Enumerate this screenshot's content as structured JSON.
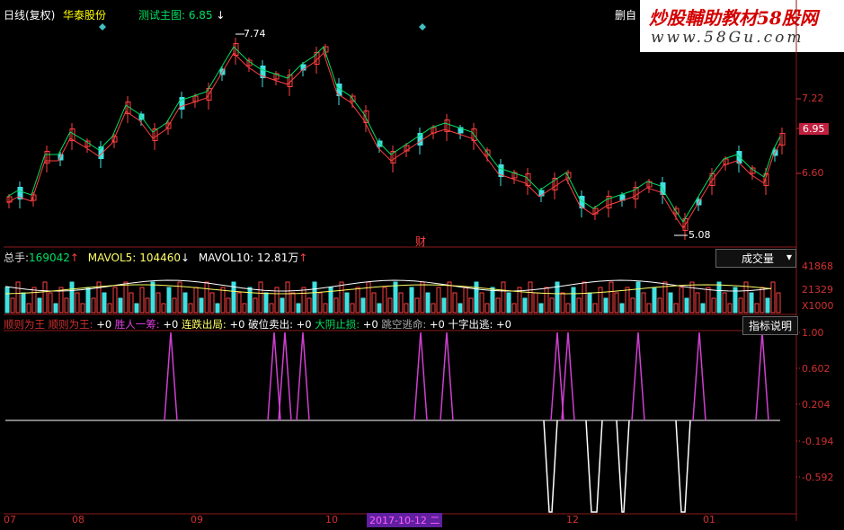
{
  "header": {
    "title": "日线(复权)",
    "stock": "华泰股份",
    "indicator": "测试主图: 6.85",
    "indicator_arrow": "↓",
    "right_btn": "删自",
    "colors": {
      "title": "#ffffff",
      "stock": "#ffff00",
      "indicator": "#00e060"
    }
  },
  "watermark": {
    "line1": "炒股輔助教材58股网",
    "line2": "www.58Gu.com"
  },
  "price_axis": {
    "p1": "7.22",
    "p2": "6.95",
    "p3": "6.60"
  },
  "annotations": {
    "high": "7.74",
    "low": "5.08",
    "cai": "财"
  },
  "volume": {
    "label_total": "总手:",
    "total": "169042",
    "mavol5_label": "MAVOL5:",
    "mavol5": "104460",
    "mavol10_label": "MAVOL10:",
    "mavol10": "12.81万",
    "dropdown": "成交量",
    "axis": {
      "v1": "41868",
      "v2": "21329",
      "v3": "X1000"
    }
  },
  "signals": {
    "items": [
      {
        "label": "顺则为王",
        "value": ""
      },
      {
        "label": "顺则为王:",
        "value": "+0"
      },
      {
        "label": "胜人一筹:",
        "value": "+0"
      },
      {
        "label": "连跌出局:",
        "value": "+0"
      },
      {
        "label": "破位卖出:",
        "value": "+0"
      },
      {
        "label": "大阴止损:",
        "value": "+0"
      },
      {
        "label": "跳空逃命:",
        "value": "+0"
      },
      {
        "label": "十字出逃:",
        "value": "+0"
      }
    ],
    "button": "指标说明",
    "axis": {
      "a1": "1.00",
      "a2": "0.602",
      "a3": "0.204",
      "a4": "-0.194",
      "a5": "-0.592"
    }
  },
  "date_axis": {
    "d07": "07",
    "d08": "08",
    "d09": "09",
    "d10": "10",
    "highlight": "2017-10-12 二",
    "d12": "12",
    "d01": "01"
  }
}
